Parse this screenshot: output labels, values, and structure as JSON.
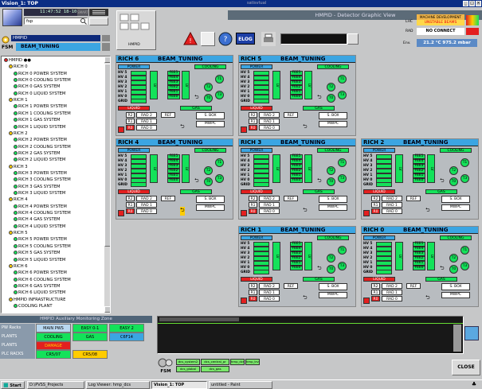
{
  "window": {
    "title": "Vision_1: TOP",
    "center_text": "satisvtual"
  },
  "topleft": {
    "clock": "11:47:52 18-10-07",
    "clock_tag": "SMART",
    "user": "fsp",
    "fsm_label": "FSM",
    "fsm_node": "HMPID",
    "fsm_state": "BEAM_TUNING"
  },
  "header": {
    "title": "HMPID - Detector Graphic View",
    "hmpid_label": "HMPID",
    "elog": "ELOG",
    "lhc_label": "LHC",
    "lhc_status1": "MACHINE DEVELOPMENT",
    "lhc_status2": "UNSTABLE BEAMS",
    "rad_label": "RAD",
    "rad_status": "NO CONNECT",
    "env_label": "Env.",
    "env_value": "21.2 °C  975.2 mbar"
  },
  "tree": {
    "items": [
      {
        "label": "HMPID ●●",
        "indent": 0
      },
      {
        "label": "RICH 0",
        "indent": 1
      },
      {
        "label": "RICH 0 POWER SYSTEM",
        "indent": 2
      },
      {
        "label": "RICH 0 COOLING SYSTEM",
        "indent": 2
      },
      {
        "label": "RICH 0 GAS SYSTEM",
        "indent": 2
      },
      {
        "label": "RICH 0 LIQUID SYSTEM",
        "indent": 2
      },
      {
        "label": "RICH 1",
        "indent": 1
      },
      {
        "label": "RICH 1 POWER SYSTEM",
        "indent": 2
      },
      {
        "label": "RICH 1 COOLING SYSTEM",
        "indent": 2
      },
      {
        "label": "RICH 1 GAS SYSTEM",
        "indent": 2
      },
      {
        "label": "RICH 1 LIQUID SYSTEM",
        "indent": 2
      },
      {
        "label": "RICH 2",
        "indent": 1
      },
      {
        "label": "RICH 2 POWER SYSTEM",
        "indent": 2
      },
      {
        "label": "RICH 2 COOLING SYSTEM",
        "indent": 2
      },
      {
        "label": "RICH 2 GAS SYSTEM",
        "indent": 2
      },
      {
        "label": "RICH 2 LIQUID SYSTEM",
        "indent": 2
      },
      {
        "label": "RICH 3",
        "indent": 1
      },
      {
        "label": "RICH 3 POWER SYSTEM",
        "indent": 2
      },
      {
        "label": "RICH 3 COOLING SYSTEM",
        "indent": 2
      },
      {
        "label": "RICH 3 GAS SYSTEM",
        "indent": 2
      },
      {
        "label": "RICH 3 LIQUID SYSTEM",
        "indent": 2
      },
      {
        "label": "RICH 4",
        "indent": 1
      },
      {
        "label": "RICH 4 POWER SYSTEM",
        "indent": 2
      },
      {
        "label": "RICH 4 COOLING SYSTEM",
        "indent": 2
      },
      {
        "label": "RICH 4 GAS SYSTEM",
        "indent": 2
      },
      {
        "label": "RICH 4 LIQUID SYSTEM",
        "indent": 2
      },
      {
        "label": "RICH 5",
        "indent": 1
      },
      {
        "label": "RICH 5 POWER SYSTEM",
        "indent": 2
      },
      {
        "label": "RICH 5 COOLING SYSTEM",
        "indent": 2
      },
      {
        "label": "RICH 5 GAS SYSTEM",
        "indent": 2
      },
      {
        "label": "RICH 5 LIQUID SYSTEM",
        "indent": 2
      },
      {
        "label": "RICH 6",
        "indent": 1
      },
      {
        "label": "RICH 6 POWER SYSTEM",
        "indent": 2
      },
      {
        "label": "RICH 6 COOLING SYSTEM",
        "indent": 2
      },
      {
        "label": "RICH 6 GAS SYSTEM",
        "indent": 2
      },
      {
        "label": "RICH 6 LIQUID SYSTEM",
        "indent": 2
      },
      {
        "label": "HMPID INFRASTRUCTURE",
        "indent": 1
      },
      {
        "label": "COOLING PLANT",
        "indent": 2
      }
    ]
  },
  "panel_labels": {
    "state": "BEAM_TUNING",
    "power": "POWER",
    "cooling": "COOLING",
    "hv_rows": [
      "HV 5",
      "HV 4",
      "HV 3",
      "HV 2",
      "HV 1",
      "HV 0"
    ],
    "grid": "GRID",
    "fee": [
      "FEE5",
      "FEE4",
      "FEE3",
      "FEE2",
      "FEE1",
      "FEE0"
    ],
    "lv": "LV",
    "t": [
      "T1",
      "T2",
      "T3",
      "T0"
    ],
    "liquid": "LIQUID",
    "gas": "GAS",
    "rads": [
      "R2",
      "R1",
      "R0"
    ],
    "rad_names": [
      "RAD 2",
      "RAD 1",
      "RAD 0"
    ],
    "ref": "REF",
    "sbox": "S. BOX",
    "mwpc": "MWPC"
  },
  "panels": [
    {
      "name": "RICH 6"
    },
    {
      "name": "RICH 5"
    },
    {
      "name": "RICH 4"
    },
    {
      "name": "RICH 3"
    },
    {
      "name": "RICH 2"
    },
    {
      "name": "RICH 1"
    },
    {
      "name": "RICH 0"
    }
  ],
  "aux": {
    "title": "HMPID Auxiliary Monitoring Zone",
    "rows": [
      {
        "label": "PW Racks",
        "cells": [
          "MAIN PWS",
          "EASY 0-1",
          "EASY 2"
        ]
      },
      {
        "label": "PLANTS",
        "cells": [
          "COOLING",
          "GAS",
          "C6F14"
        ]
      },
      {
        "label": "PLANTS",
        "cells": [
          "DAMAGE"
        ]
      },
      {
        "label": "PLC RACKS",
        "cells": [
          "CR5/07",
          "CR5/08"
        ]
      }
    ]
  },
  "bottom": {
    "fsm": "FSM",
    "dcs": [
      "dcs_system2",
      "dcs_central_pr",
      "hmp_dcs",
      "hmp_trvw",
      "dcs_global",
      "dcs_gas"
    ],
    "close": "CLOSE"
  },
  "taskbar": {
    "start": "Start",
    "items": [
      "D:\\PVSS_Projects",
      "Log Viewer: hmp_dcs",
      "Vision_1: TOP",
      "untitled - Paint"
    ]
  },
  "colors": {
    "accent": "#3ba5e2",
    "ok": "#14e25a",
    "alarm": "#e31f1f",
    "warn": "#ffcc00"
  }
}
